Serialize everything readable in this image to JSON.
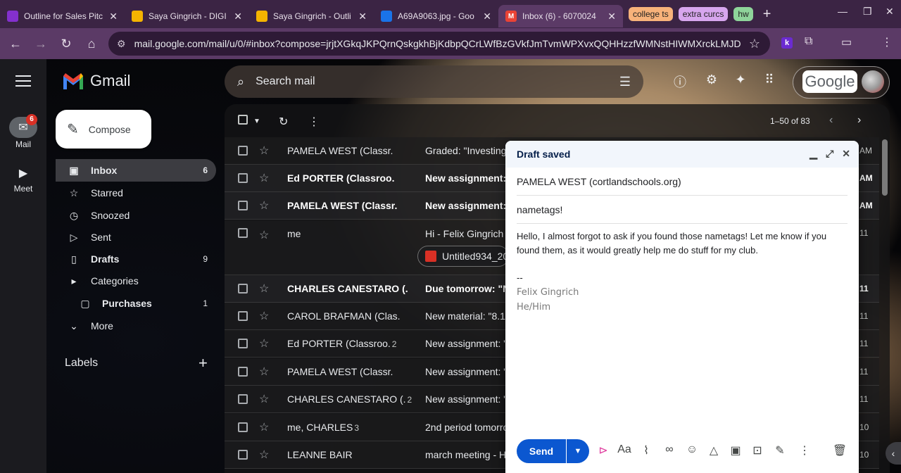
{
  "browser": {
    "tabs": [
      {
        "title": "Outline for Sales Pitc",
        "favicon_color": "#8430ce",
        "favicon": "■"
      },
      {
        "title": "Saya Gingrich - DIGI",
        "favicon_color": "#f4b400",
        "favicon": "■"
      },
      {
        "title": "Saya Gingrich - Outli",
        "favicon_color": "#f4b400",
        "favicon": "■"
      },
      {
        "title": "A69A9063.jpg - Goo",
        "favicon_color": "#1a73e8",
        "favicon": "▲"
      },
      {
        "title": "Inbox (6) - 6070024",
        "favicon_color": "#ea4335",
        "favicon": "M"
      }
    ],
    "tab_groups": [
      {
        "label": "college ts",
        "color": "#f7b27a"
      },
      {
        "label": "extra curcs",
        "color": "#d7a6ee"
      },
      {
        "label": "hw",
        "color": "#8ed49a"
      }
    ],
    "url": "mail.google.com/mail/u/0/#inbox?compose=jrjtXGkqJKPQrnQskgkhBjKdbpQCrLWfBzGVkfJmTvmWPXvxQQHHzzfWMNstHIWMXrckLMJD",
    "extension_k": "k"
  },
  "rail": {
    "mail_label": "Mail",
    "mail_badge": "6",
    "meet_label": "Meet"
  },
  "app": {
    "name": "Gmail",
    "compose_label": "Compose",
    "search_placeholder": "Search mail",
    "account_brand": "Google"
  },
  "nav": [
    {
      "label": "Inbox",
      "count": "6",
      "icon": "inbox-icon",
      "glyph": "▣",
      "active": true
    },
    {
      "label": "Starred",
      "count": "",
      "icon": "star-icon",
      "glyph": "☆"
    },
    {
      "label": "Snoozed",
      "count": "",
      "icon": "clock-icon",
      "glyph": "◷"
    },
    {
      "label": "Sent",
      "count": "",
      "icon": "send-icon",
      "glyph": "▷"
    },
    {
      "label": "Drafts",
      "count": "9",
      "icon": "draft-icon",
      "glyph": "▯",
      "bold": true
    },
    {
      "label": "Categories",
      "count": "",
      "icon": "label-icon",
      "glyph": "▸"
    },
    {
      "label": "Purchases",
      "count": "1",
      "icon": "tag-icon",
      "glyph": "▢",
      "bold": true
    },
    {
      "label": "More",
      "count": "",
      "icon": "chevron-down-icon",
      "glyph": "⌄"
    }
  ],
  "labels_heading": "Labels",
  "pager": "1–50 of 83",
  "emails": [
    {
      "sender": "PAMELA WEST (Classr.",
      "count": "",
      "subject": "Graded: \"Investing A",
      "date": "AM",
      "unread": false
    },
    {
      "sender": "Ed PORTER (Classroo.",
      "count": "",
      "subject": "New assignment: \"",
      "date": "AM",
      "unread": true
    },
    {
      "sender": "PAMELA WEST (Classr.",
      "count": "",
      "subject": "New assignment: \"I",
      "date": "AM",
      "unread": true
    },
    {
      "sender": "me",
      "count": "",
      "subject": "Hi - Felix Gingrich He",
      "date": "11",
      "unread": false
    },
    {
      "sender": "CHARLES CANESTARO (.",
      "count": "",
      "subject": "Due tomorrow: \"No",
      "date": "11",
      "unread": true
    },
    {
      "sender": "CAROL BRAFMAN (Clas.",
      "count": "",
      "subject": "New material: \"8.1 Sc",
      "date": "11",
      "unread": false
    },
    {
      "sender": "Ed PORTER (Classroo.",
      "count": "2",
      "subject": "New assignment: \"M",
      "date": "11",
      "unread": false
    },
    {
      "sender": "PAMELA WEST (Classr.",
      "count": "",
      "subject": "New assignment: \"In",
      "date": "11",
      "unread": false
    },
    {
      "sender": "CHARLES CANESTARO (.",
      "count": "2",
      "subject": "New assignment: \"Lu",
      "date": "11",
      "unread": false
    },
    {
      "sender": "me, CHARLES",
      "count": "3",
      "subject": "2nd period tomorrow",
      "date": "10",
      "unread": false
    },
    {
      "sender": "LEANNE BAIR",
      "count": "",
      "subject": "march meeting - Hey",
      "date": "10",
      "unread": false
    }
  ],
  "attachment_name": "Untitled934_20",
  "compose": {
    "status": "Draft saved",
    "to": "PAMELA WEST (cortlandschools.org)",
    "subject": "nametags!",
    "body": "Hello, I almost forgot to ask if you found those nametags! Let me know if you found them, as it would greatly help me do stuff for my club.",
    "sig_dash": "--",
    "sig_name": "Felix Gingrich",
    "sig_pronouns": "He/Him",
    "send_label": "Send",
    "format_label": "Aa"
  },
  "colors": {
    "accent": "#0b57d0",
    "badge": "#d93025"
  }
}
